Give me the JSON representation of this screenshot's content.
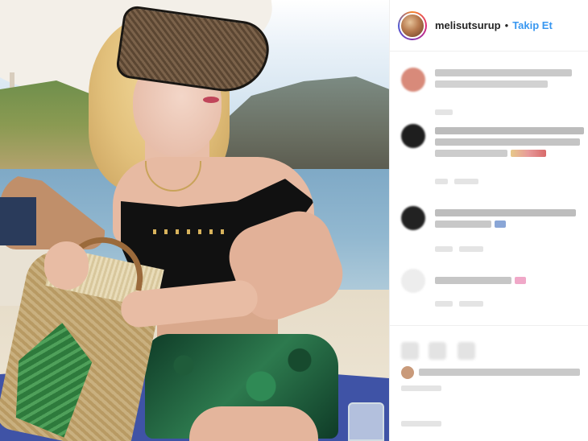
{
  "post": {
    "username": "melisutsurup",
    "separator": "•",
    "follow_label": "Takip Et"
  },
  "colors": {
    "follow_blue": "#3897f0",
    "text_dark": "#262626",
    "border": "#efefef",
    "story_ring": [
      "#f58529",
      "#dd2a7b",
      "#8134af",
      "#515bd4"
    ]
  },
  "icons": {
    "like": "heart-icon",
    "comment": "comment-icon",
    "share": "share-icon"
  },
  "comments_note": "Comment text and avatars are pixelated/blurred in the screenshot and unreadable"
}
